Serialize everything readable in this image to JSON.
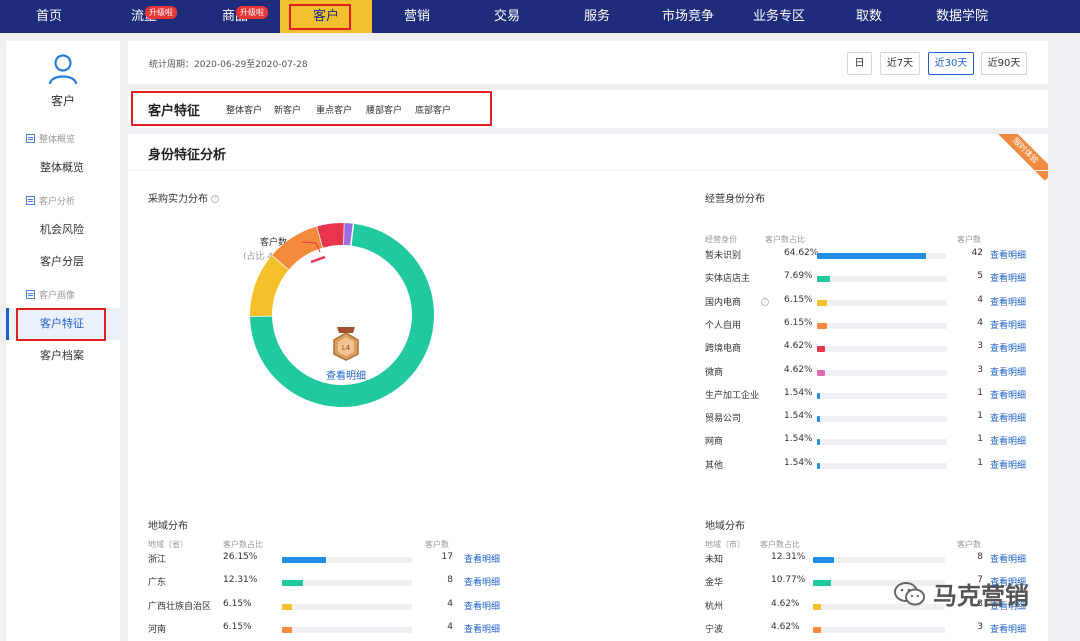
{
  "nav": {
    "items": [
      {
        "label": "首页",
        "badge": ""
      },
      {
        "label": "流量",
        "badge": "升级啦"
      },
      {
        "label": "商品",
        "badge": "升级啦"
      },
      {
        "label": "客户",
        "badge": ""
      },
      {
        "label": "营销",
        "badge": ""
      },
      {
        "label": "交易",
        "badge": ""
      },
      {
        "label": "服务",
        "badge": ""
      },
      {
        "label": "市场竞争",
        "badge": ""
      },
      {
        "label": "业务专区",
        "badge": ""
      },
      {
        "label": "取数",
        "badge": ""
      },
      {
        "label": "数据学院",
        "badge": ""
      }
    ],
    "active": "客户"
  },
  "sidebar": {
    "title": "客户",
    "groups": [
      {
        "label": "整体概览",
        "items": [
          "整体概览"
        ]
      },
      {
        "label": "客户分析",
        "items": [
          "机会风险",
          "客户分层"
        ]
      },
      {
        "label": "客户画像",
        "items": [
          "客户特征",
          "客户档案"
        ]
      }
    ],
    "active": "客户特征"
  },
  "period": {
    "text": "统计周期：2020-06-29至2020-07-28",
    "buttons": [
      "日",
      "近7天",
      "近30天",
      "近90天"
    ],
    "active": "近30天"
  },
  "customer_tabs": {
    "title": "客户特征",
    "tabs": [
      "整体客户",
      "新客户",
      "重点客户",
      "腰部客户",
      "底部客户"
    ]
  },
  "identity": {
    "title": "身份特征分析",
    "corner_badge": "限时体验",
    "purchase": {
      "title": "采购实力分布",
      "help": "?",
      "callout_line1": "客户数 3",
      "callout_line2": "(占比 4.62%)",
      "center_level": "L4",
      "center_link": "查看明细"
    },
    "business": {
      "title": "经营身份分布",
      "headers": [
        "经营身份",
        "客户数占比",
        "客户数"
      ],
      "rows": [
        {
          "name": "暂未识别",
          "pct": "64.62%",
          "frac": 0.6462,
          "count": "42",
          "color": "#1f8ce8",
          "link": "查看明细",
          "help": ""
        },
        {
          "name": "实体店店主",
          "pct": "7.69%",
          "frac": 0.0769,
          "count": "5",
          "color": "#20c9a0",
          "link": "查看明细",
          "help": ""
        },
        {
          "name": "国内电商",
          "pct": "6.15%",
          "frac": 0.0615,
          "count": "4",
          "color": "#f5c02a",
          "link": "查看明细",
          "help": "?"
        },
        {
          "name": "个人自用",
          "pct": "6.15%",
          "frac": 0.0615,
          "count": "4",
          "color": "#f58a3c",
          "link": "查看明细",
          "help": ""
        },
        {
          "name": "跨境电商",
          "pct": "4.62%",
          "frac": 0.0462,
          "count": "3",
          "color": "#e8354f",
          "link": "查看明细",
          "help": ""
        },
        {
          "name": "微商",
          "pct": "4.62%",
          "frac": 0.0462,
          "count": "3",
          "color": "#e06ab0",
          "link": "查看明细",
          "help": ""
        },
        {
          "name": "生产加工企业",
          "pct": "1.54%",
          "frac": 0.0154,
          "count": "1",
          "color": "#1f8ce8",
          "link": "查看明细",
          "help": ""
        },
        {
          "name": "贸易公司",
          "pct": "1.54%",
          "frac": 0.0154,
          "count": "1",
          "color": "#1f8ce8",
          "link": "查看明细",
          "help": ""
        },
        {
          "name": "网商",
          "pct": "1.54%",
          "frac": 0.0154,
          "count": "1",
          "color": "#1f8ce8",
          "link": "查看明细",
          "help": ""
        },
        {
          "name": "其他",
          "pct": "1.54%",
          "frac": 0.0154,
          "count": "1",
          "color": "#1f8ce8",
          "link": "查看明细",
          "help": ""
        }
      ]
    },
    "region_province": {
      "title": "地域分布",
      "headers": [
        "地域（省）",
        "客户数占比",
        "客户数"
      ],
      "rows": [
        {
          "name": "浙江",
          "pct": "26.15%",
          "frac": 0.2615,
          "count": "17",
          "color": "#1f8ce8",
          "link": "查看明细"
        },
        {
          "name": "广东",
          "pct": "12.31%",
          "frac": 0.1231,
          "count": "8",
          "color": "#20c9a0",
          "link": "查看明细"
        },
        {
          "name": "广西壮族自治区",
          "pct": "6.15%",
          "frac": 0.0615,
          "count": "4",
          "color": "#f5c02a",
          "link": "查看明细"
        },
        {
          "name": "河南",
          "pct": "6.15%",
          "frac": 0.0615,
          "count": "4",
          "color": "#f58a3c",
          "link": "查看明细"
        }
      ]
    },
    "region_city": {
      "title": "地域分布",
      "headers": [
        "地域（市）",
        "客户数占比",
        "客户数"
      ],
      "rows": [
        {
          "name": "未知",
          "pct": "12.31%",
          "frac": 0.1231,
          "count": "8",
          "color": "#1f8ce8",
          "link": "查看明细"
        },
        {
          "name": "金华",
          "pct": "10.77%",
          "frac": 0.1077,
          "count": "7",
          "color": "#20c9a0",
          "link": "查看明细"
        },
        {
          "name": "杭州",
          "pct": "4.62%",
          "frac": 0.0462,
          "count": "3",
          "color": "#f5c02a",
          "link": "查看明细"
        },
        {
          "name": "宁波",
          "pct": "4.62%",
          "frac": 0.0462,
          "count": "3",
          "color": "#f58a3c",
          "link": "查看明细"
        }
      ]
    }
  },
  "chart_data": {
    "type": "pie",
    "title": "采购实力分布",
    "slices": [
      {
        "value": 0.7,
        "color": "#20c9a0"
      },
      {
        "value": 0.11,
        "color": "#f5c02a"
      },
      {
        "value": 0.09,
        "color": "#f58a3c"
      },
      {
        "value": 0.0462,
        "color": "#e8354f"
      },
      {
        "value": 0.015,
        "color": "#9b6ee0"
      }
    ],
    "annotation": "客户数 3 (占比 4.62%)"
  },
  "watermark": {
    "text": "马克营销"
  }
}
